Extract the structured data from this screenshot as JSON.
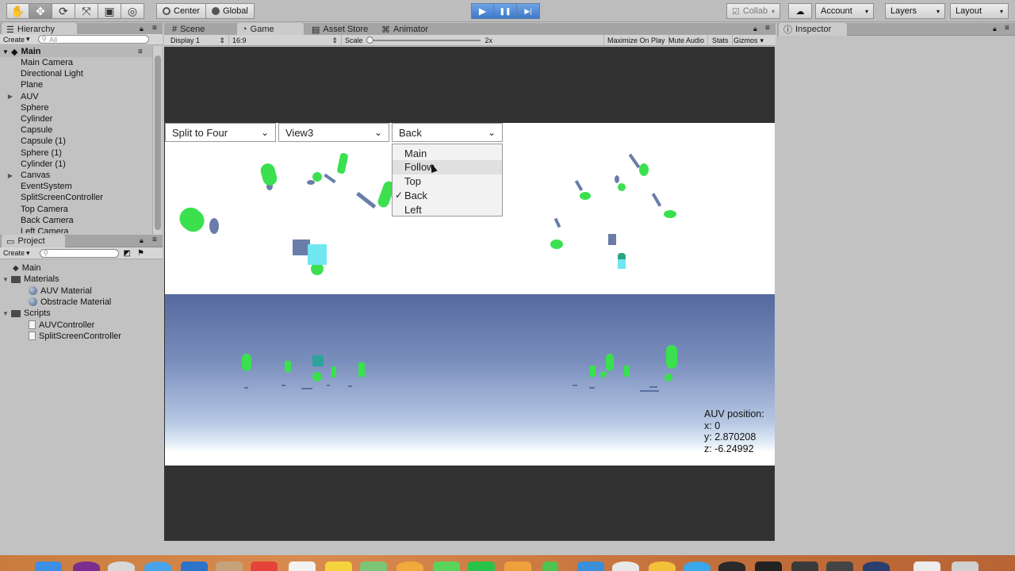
{
  "toolbar": {
    "tools": [
      {
        "name": "hand-tool-icon",
        "glyph": "✋"
      },
      {
        "name": "move-tool-icon",
        "glyph": "✥"
      },
      {
        "name": "rotate-tool-icon",
        "glyph": "⟳"
      },
      {
        "name": "scale-tool-icon",
        "glyph": "⤧"
      },
      {
        "name": "rect-tool-icon",
        "glyph": "▣"
      },
      {
        "name": "transform-tool-icon",
        "glyph": "◎"
      }
    ],
    "center_label": "Center",
    "global_label": "Global",
    "play_glyph": "▶",
    "pause_glyph": "❚❚",
    "step_glyph": "▶|",
    "collab_label": "Collab",
    "cloud_glyph": "☁",
    "account_label": "Account",
    "layers_label": "Layers",
    "layout_label": "Layout",
    "dropdown_arrow": "▾"
  },
  "hierarchy": {
    "tab_label": "Hierarchy",
    "create_label": "Create",
    "search_placeholder": "All",
    "scene_name": "Main",
    "items": [
      {
        "label": "Main Camera",
        "expandable": false
      },
      {
        "label": "Directional Light",
        "expandable": false
      },
      {
        "label": "Plane",
        "expandable": false
      },
      {
        "label": "AUV",
        "expandable": true
      },
      {
        "label": "Sphere",
        "expandable": false
      },
      {
        "label": "Cylinder",
        "expandable": false
      },
      {
        "label": "Capsule",
        "expandable": false
      },
      {
        "label": "Capsule (1)",
        "expandable": false
      },
      {
        "label": "Sphere (1)",
        "expandable": false
      },
      {
        "label": "Cylinder (1)",
        "expandable": false
      },
      {
        "label": "Canvas",
        "expandable": true
      },
      {
        "label": "EventSystem",
        "expandable": false
      },
      {
        "label": "SplitScreenController",
        "expandable": false
      },
      {
        "label": "Top Camera",
        "expandable": false
      },
      {
        "label": "Back Camera",
        "expandable": false
      },
      {
        "label": "Left Camera",
        "expandable": false
      }
    ]
  },
  "project": {
    "tab_label": "Project",
    "create_label": "Create",
    "items": [
      {
        "label": "Main",
        "kind": "scene"
      },
      {
        "label": "Materials",
        "kind": "folder"
      },
      {
        "label": "AUV Material",
        "kind": "material"
      },
      {
        "label": "Obstracle Material",
        "kind": "material"
      },
      {
        "label": "Scripts",
        "kind": "folder"
      },
      {
        "label": "AUVController",
        "kind": "script"
      },
      {
        "label": "SplitScreenController",
        "kind": "script"
      }
    ]
  },
  "tabs": {
    "scene": "Scene",
    "game": "Game",
    "asset_store": "Asset Store",
    "animator": "Animator",
    "inspector": "Inspector"
  },
  "game_bar": {
    "display": "Display 1",
    "aspect": "16:9",
    "scale_label": "Scale",
    "scale_value": "2x",
    "maximize": "Maximize On Play",
    "mute": "Mute Audio",
    "stats": "Stats",
    "gizmos": "Gizmos"
  },
  "game": {
    "dropdown_mode": "Split to Four",
    "dropdown_view": "View3",
    "dropdown_camera": "Back",
    "camera_options": [
      "Main",
      "Follow",
      "Top",
      "Back",
      "Left"
    ],
    "selected_option": "Back",
    "hovered_option": "Follow",
    "check_glyph": "✓",
    "auv_title": "AUV position:",
    "auv_x": "x: 0",
    "auv_y": "y: 2.870208",
    "auv_z": "z: -6.24992",
    "colors": {
      "object_green": "#3be04f",
      "cube_cyan": "#6fe7f0",
      "shadow": "#59709f"
    }
  }
}
